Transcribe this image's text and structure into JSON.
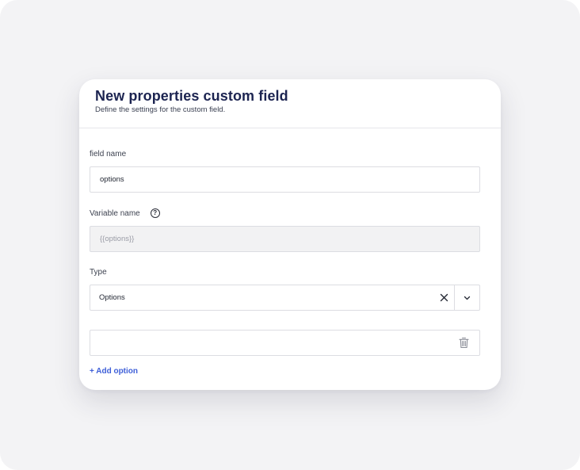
{
  "modal": {
    "title": "New properties custom field",
    "subtitle": "Define the settings for the custom field."
  },
  "fields": {
    "field_name": {
      "label": "field name",
      "value": "options"
    },
    "variable_name": {
      "label": "Variable name",
      "value": "{{options}}",
      "help_icon": "question-circle-icon"
    },
    "type": {
      "label": "Type",
      "selected": "Options",
      "clear_icon": "close-icon",
      "toggle_icon": "chevron-down-icon"
    }
  },
  "options": {
    "items": [
      {
        "value": "",
        "delete_icon": "trash-icon"
      }
    ],
    "add_label": "+ Add option"
  },
  "colors": {
    "title": "#1c2451",
    "accent": "#3e5fd8",
    "border": "#dcdde2",
    "disabled_bg": "#f2f2f3"
  }
}
